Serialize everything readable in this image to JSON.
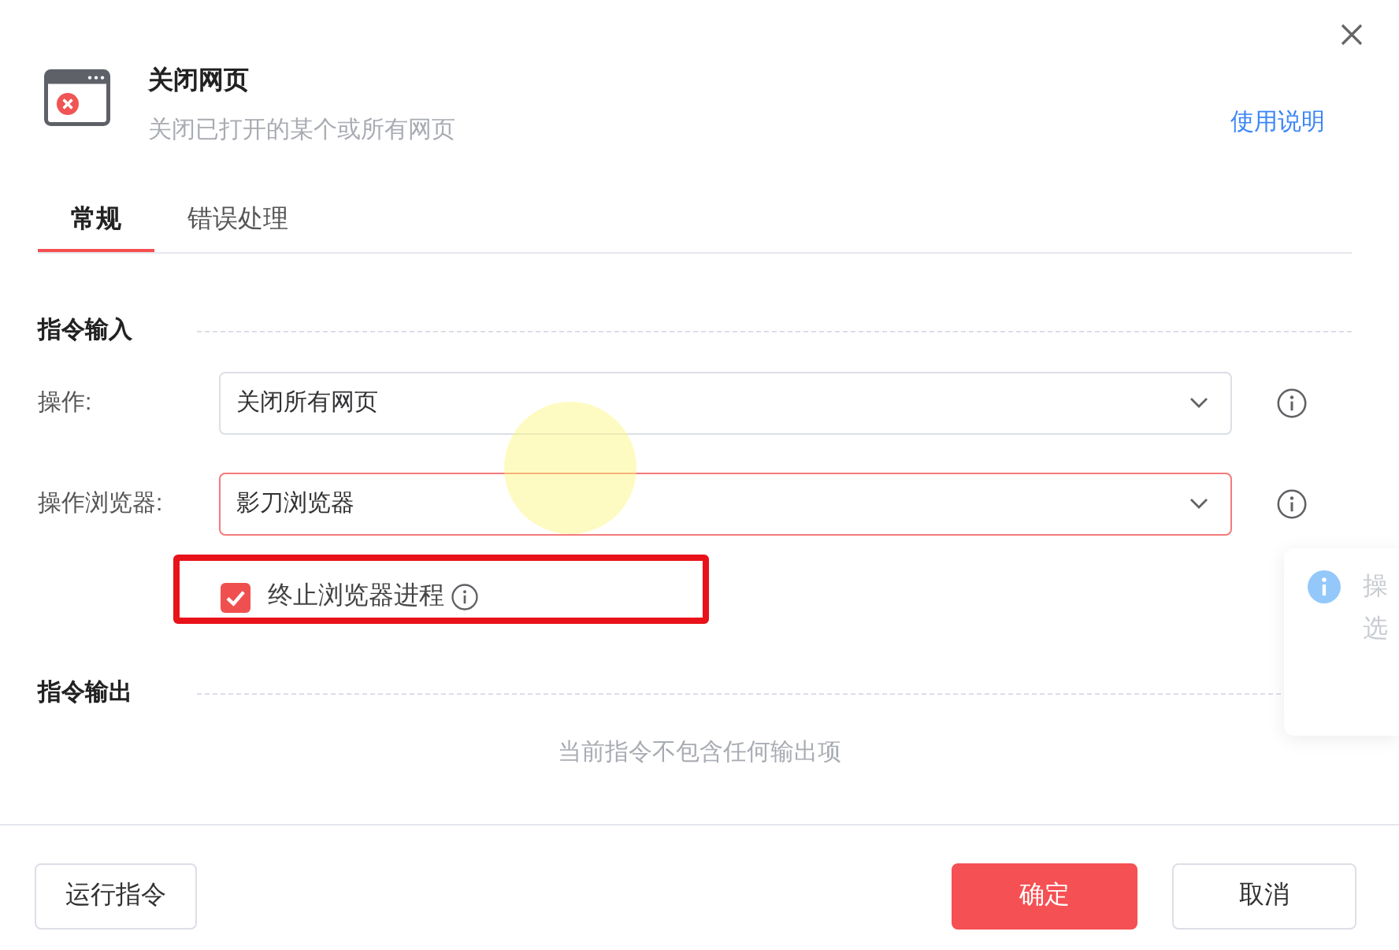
{
  "dialog": {
    "title": "关闭网页",
    "subtitle": "关闭已打开的某个或所有网页",
    "help_link": "使用说明"
  },
  "tabs": [
    {
      "label": "常规",
      "selected": true
    },
    {
      "label": "错误处理",
      "selected": false
    }
  ],
  "input_section": {
    "title": "指令输入",
    "fields": [
      {
        "label": "操作:",
        "value": "关闭所有网页",
        "focused": false
      },
      {
        "label": "操作浏览器:",
        "value": "影刀浏览器",
        "focused": true
      }
    ],
    "options": [
      {
        "label": "终止浏览器进程",
        "checked": true,
        "highlighted": true
      }
    ]
  },
  "output_section": {
    "title": "指令输出",
    "empty_message": "当前指令不包含任何输出项"
  },
  "tooltip": {
    "lines": [
      "操",
      "选"
    ]
  },
  "footer": {
    "buttons": [
      {
        "label": "运行指令",
        "kind": "default"
      },
      {
        "label": "确定",
        "kind": "primary"
      },
      {
        "label": "取消",
        "kind": "default"
      }
    ]
  },
  "click_marker": true
}
